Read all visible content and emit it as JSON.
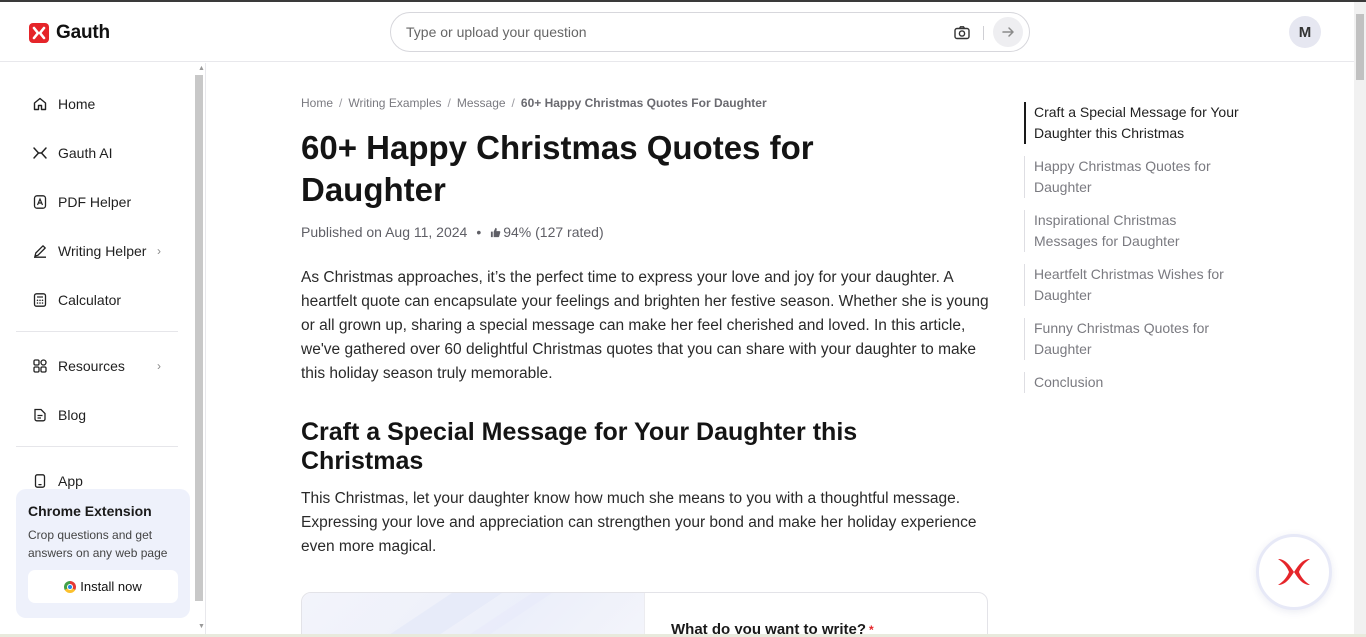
{
  "brand": {
    "name": "Gauth",
    "accent": "#e5252a"
  },
  "search": {
    "placeholder": "Type or upload your question"
  },
  "user": {
    "initial": "M"
  },
  "sidebar": {
    "items": [
      {
        "label": "Home",
        "icon": "home-icon"
      },
      {
        "label": "Gauth AI",
        "icon": "gauth-ai-icon"
      },
      {
        "label": "PDF Helper",
        "icon": "pdf-icon"
      },
      {
        "label": "Writing Helper",
        "icon": "pen-icon",
        "has_submenu": true
      },
      {
        "label": "Calculator",
        "icon": "calculator-icon"
      },
      {
        "label": "Resources",
        "icon": "grid-icon",
        "has_submenu": true
      },
      {
        "label": "Blog",
        "icon": "blog-icon"
      },
      {
        "label": "App",
        "icon": "phone-icon"
      }
    ],
    "promo": {
      "title": "Chrome Extension",
      "text": "Crop questions and get answers on any web page",
      "button": "Install now"
    }
  },
  "breadcrumb": [
    "Home",
    "Writing Examples",
    "Message",
    "60+ Happy Christmas Quotes For Daughter"
  ],
  "article": {
    "title": "60+ Happy Christmas Quotes for Daughter",
    "published": "Published on Aug 11, 2024",
    "rating": "94% (127 rated)",
    "intro": "As Christmas approaches, it’s the perfect time to express your love and joy for your daughter. A heartfelt quote can encapsulate your feelings and brighten her festive season. Whether she is young or all grown up, sharing a special message can make her feel cherished and loved. In this article, we've gathered over 60 delightful Christmas quotes that you can share with your daughter to make this holiday season truly memorable.",
    "section_title": "Craft a Special Message for Your Daughter this Christmas",
    "section_text": "This Christmas, let your daughter know how much she means to you with a thoughtful message. Expressing your love and appreciation can strengthen your bond and make her holiday experience even more magical.",
    "writer_prompt": "What do you want to write?"
  },
  "toc": [
    "Craft a Special Message for Your Daughter this Christmas",
    "Happy Christmas Quotes for Daughter",
    "Inspirational Christmas Messages for Daughter",
    "Heartfelt Christmas Wishes for Daughter",
    "Funny Christmas Quotes for Daughter",
    "Conclusion"
  ]
}
